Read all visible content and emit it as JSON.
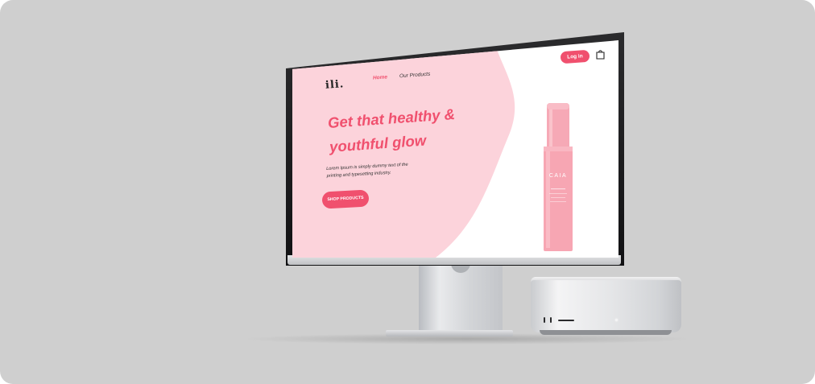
{
  "site": {
    "logo": "ili.",
    "nav": {
      "home": "Home",
      "products": "Our Products"
    },
    "login_label": "Log in",
    "headline_line1": "Get that healthy &",
    "headline_line2": "youthful glow",
    "subtext_line1": "Lorem Ipsum is simply dummy text of the",
    "subtext_line2": "printing and typesetting industry.",
    "cta_label": "SHOP PRODUCTS",
    "product_brand": "CAIA"
  },
  "colors": {
    "background": "#cfcfcf",
    "hero_pink": "#fcd3db",
    "accent": "#f0506e",
    "product": "#f7a6b3"
  },
  "icons": {
    "cart": "shopping-bag-icon"
  }
}
